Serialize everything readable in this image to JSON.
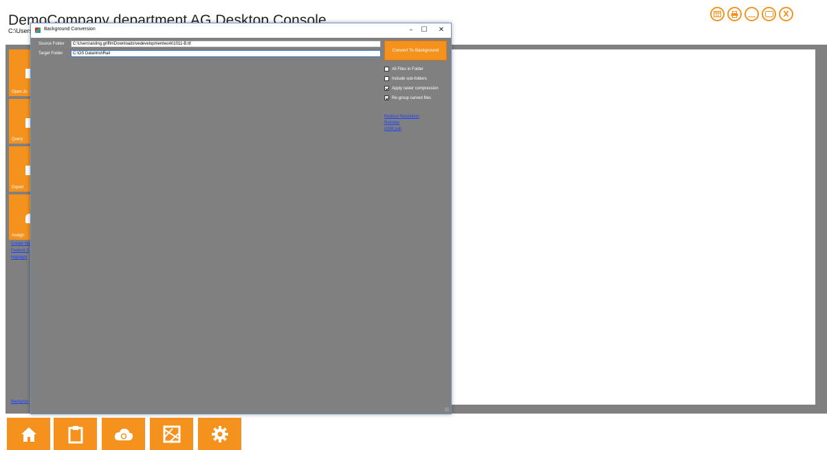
{
  "app": {
    "title": "DemoCompany department AG Desktop Console",
    "path": "C:\\Users"
  },
  "window_controls": [
    "table-icon",
    "print-icon",
    "minimize-icon",
    "restore-icon",
    "close-icon"
  ],
  "window_close_label": "X",
  "sidebar": {
    "tiles": [
      {
        "label": "Open Jo",
        "icon": "open-job-icon"
      },
      {
        "label": "Query",
        "icon": "query-icon"
      },
      {
        "label": "Export",
        "icon": "export-icon"
      },
      {
        "label": "Assign",
        "icon": "assign-icon"
      }
    ],
    "links": [
      "Create Ne",
      "Feature S",
      "Highlight"
    ],
    "bottom_link": "Backgrou"
  },
  "bottom_nav": [
    "home-icon",
    "clipboard-icon",
    "cloud-sync-icon",
    "map-icon",
    "settings-icon"
  ],
  "dialog": {
    "title": "Background Conversion",
    "controls": {
      "minimize": "–",
      "maximize": "☐",
      "close": "✕"
    },
    "source_label": "Source Folder",
    "source_value": "C:\\Users\\aisling.griffin\\Downloads\\vedevelopmentwork\\1011-B.tif",
    "target_label": "Target Folder",
    "target_value": "C:\\OS Data\\IrishRail",
    "convert_button": "Convert To Background",
    "options": [
      {
        "label": "All Files in Folder",
        "checked": false
      },
      {
        "label": "Include sub-folders",
        "checked": false
      },
      {
        "label": "Apply raster compression",
        "checked": true
      },
      {
        "label": "Re-group carved files",
        "checked": true
      }
    ],
    "links": [
      "Reduce Resolution",
      "Reindex",
      "OSM pull"
    ]
  },
  "colors": {
    "accent": "#f5921e",
    "workspace": "#808080",
    "link": "#1a3fff"
  }
}
